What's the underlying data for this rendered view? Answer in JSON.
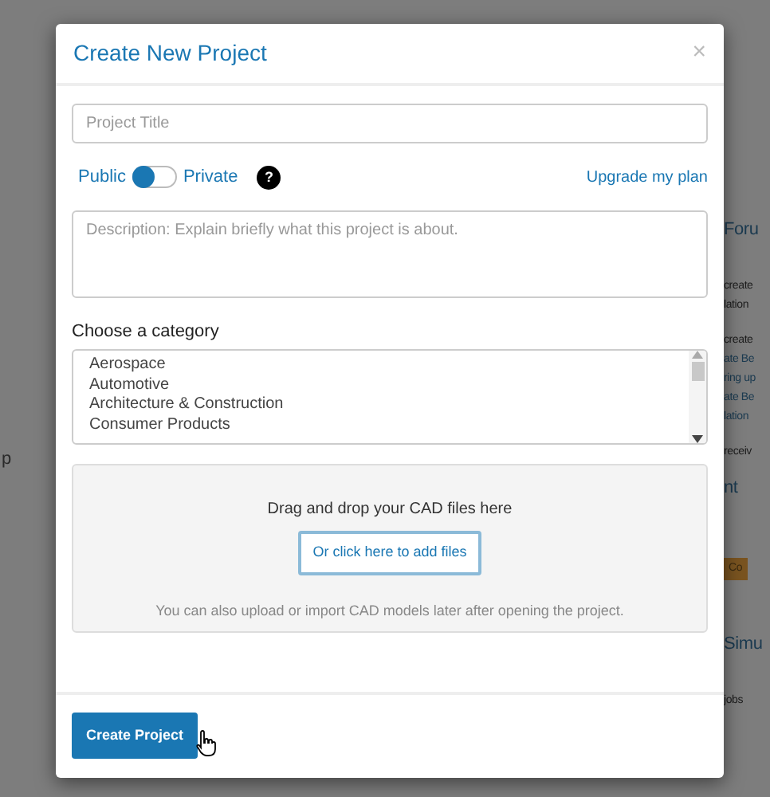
{
  "background": {
    "left_fragment": "p",
    "right_fragments": [
      {
        "kind": "heading",
        "text": "Foru"
      },
      {
        "kind": "line",
        "text": "create"
      },
      {
        "kind": "line",
        "text": "lation"
      },
      {
        "kind": "gap",
        "text": "create"
      },
      {
        "kind": "link",
        "text": "ate Be"
      },
      {
        "kind": "link",
        "text": "ring up"
      },
      {
        "kind": "link",
        "text": "ate Be"
      },
      {
        "kind": "link",
        "text": "lation"
      },
      {
        "kind": "gap",
        "text": "receiv"
      },
      {
        "kind": "heading",
        "text": "nt"
      },
      {
        "kind": "badge",
        "text": "Co"
      },
      {
        "kind": "heading",
        "text": "Simu"
      },
      {
        "kind": "line",
        "text": "jobs"
      }
    ]
  },
  "modal": {
    "title": "Create New Project",
    "close": "×",
    "title_field": {
      "placeholder": "Project Title"
    },
    "visibility": {
      "left_label": "Public",
      "right_label": "Private",
      "private": false,
      "help": "?"
    },
    "upgrade_link": "Upgrade my plan",
    "description": {
      "placeholder": "Description: Explain briefly what this project is about."
    },
    "category_label": "Choose a category",
    "categories": [
      {
        "label": "Aerospace",
        "selected": false
      },
      {
        "label": "Automotive",
        "selected": false
      },
      {
        "label": "Architecture & Construction",
        "selected": false
      },
      {
        "label": "Consumer Products",
        "selected": false
      }
    ],
    "dropzone": {
      "heading": "Drag and drop your CAD files here",
      "button": "Or click here to add files",
      "note": "You can also upload or import CAD models later after opening the project."
    },
    "submit": "Create Project"
  }
}
